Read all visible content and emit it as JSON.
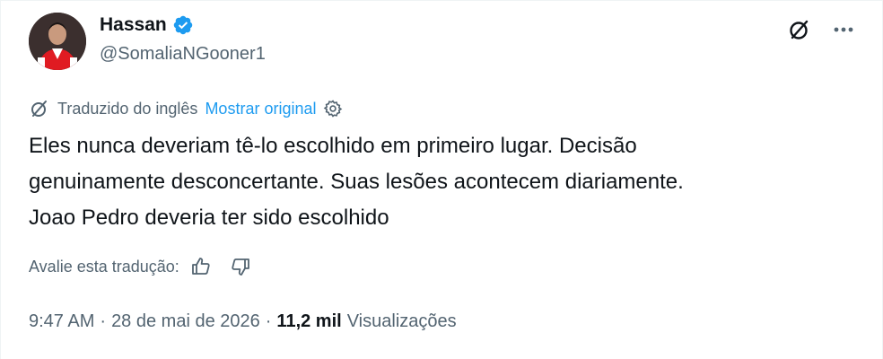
{
  "author": {
    "display_name": "Hassan",
    "handle": "@SomaliaNGooner1",
    "verified": true,
    "verified_color": "#1d9bf0"
  },
  "icons": {
    "grok": "grok-icon",
    "more": "more-icon",
    "translate": "translate-icon",
    "settings": "gear-icon",
    "thumbs_up": "thumbs-up-icon",
    "thumbs_down": "thumbs-down-icon"
  },
  "translation": {
    "label": "Traduzido do inglês",
    "show_original": "Mostrar original"
  },
  "tweet": {
    "lines": [
      "Eles nunca deveriam tê-lo escolhido em primeiro lugar. Decisão",
      "genuinamente desconcertante. Suas lesões acontecem diariamente.",
      "Joao Pedro deveria ter sido escolhido"
    ]
  },
  "rating": {
    "label": "Avalie esta tradução:"
  },
  "meta": {
    "time": "9:47 AM",
    "separator": "·",
    "date": "28 de mai de 2026",
    "views_count": "11,2 mil",
    "views_label": "Visualizações"
  },
  "colors": {
    "text_primary": "#0f1419",
    "text_secondary": "#536471",
    "link": "#1d9bf0"
  }
}
